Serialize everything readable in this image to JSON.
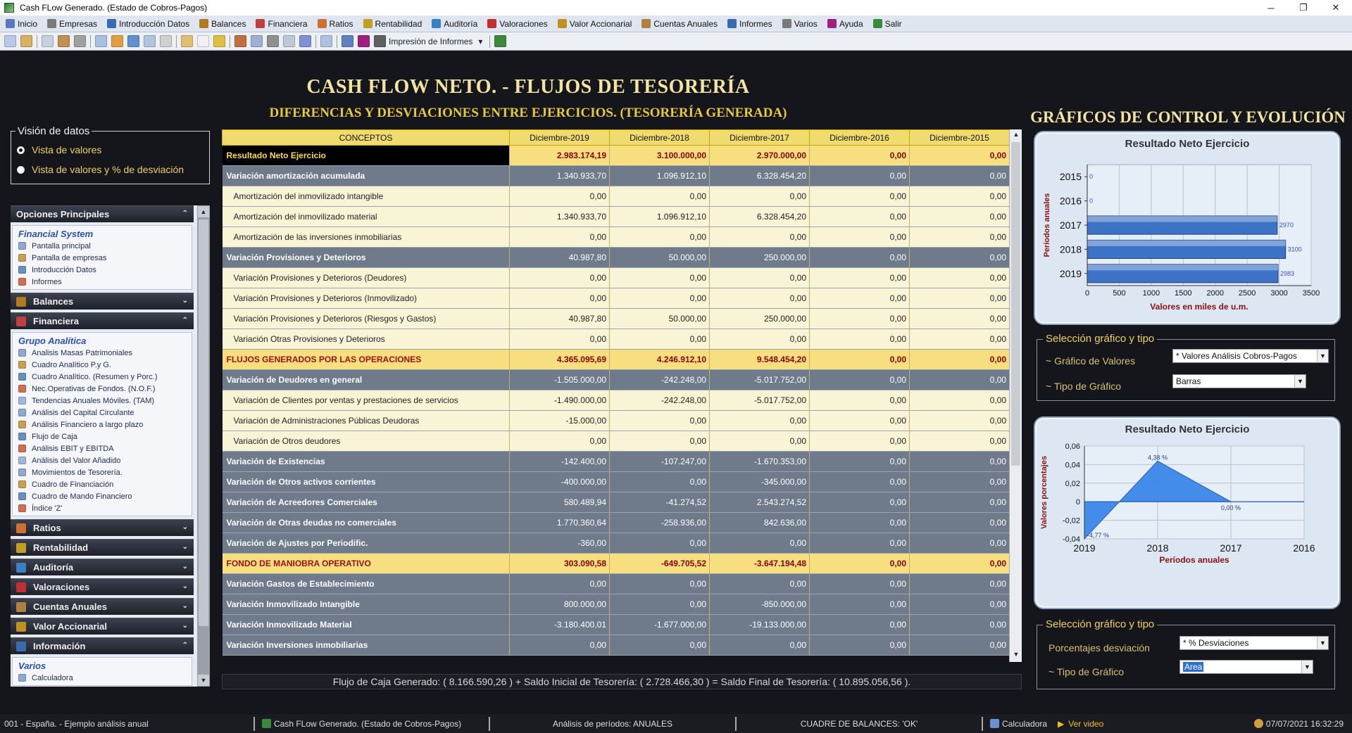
{
  "window": {
    "title": "Cash FLow Generado. (Estado de Cobros-Pagos)",
    "minimize": "─",
    "maximize": "❐",
    "close": "✕"
  },
  "menu": [
    {
      "label": "Inicio",
      "icon": "home-icon",
      "color": "#5a78c0"
    },
    {
      "label": "Empresas",
      "icon": "companies-icon",
      "color": "#7a7a7a"
    },
    {
      "label": "Introducción Datos",
      "icon": "data-entry-icon",
      "color": "#3a6ab0"
    },
    {
      "label": "Balances",
      "icon": "balance-icon",
      "color": "#b07a20"
    },
    {
      "label": "Financiera",
      "icon": "financial-icon",
      "color": "#c04040"
    },
    {
      "label": "Ratios",
      "icon": "ratios-icon",
      "color": "#d07030"
    },
    {
      "label": "Rentabilidad",
      "icon": "profitability-icon",
      "color": "#c0a020"
    },
    {
      "label": "Auditoría",
      "icon": "audit-icon",
      "color": "#3a80c0"
    },
    {
      "label": "Valoraciones",
      "icon": "valuation-icon",
      "color": "#c03030"
    },
    {
      "label": "Valor Accionarial",
      "icon": "shareholder-icon",
      "color": "#c09020"
    },
    {
      "label": "Cuentas Anuales",
      "icon": "annual-accounts-icon",
      "color": "#b08040"
    },
    {
      "label": "Informes",
      "icon": "reports-icon",
      "color": "#3a6ab0"
    },
    {
      "label": "Varios",
      "icon": "misc-icon",
      "color": "#7a7a7a"
    },
    {
      "label": "Ayuda",
      "icon": "help-icon",
      "color": "#a02080"
    },
    {
      "label": "Salir",
      "icon": "exit-icon",
      "color": "#3a8a3a"
    }
  ],
  "toolbar": {
    "print_label": "Impresión de Informes",
    "print_arrow": "▾"
  },
  "heading": {
    "title": "CASH FLOW NETO. - FLUJOS DE TESORERÍA",
    "subtitle": "DIFERENCIAS Y DESVIACIONES ENTRE EJERCICIOS. (TESORERÍA GENERADA)",
    "charts_title": "GRÁFICOS DE CONTROL Y EVOLUCIÓN"
  },
  "vision": {
    "legend": "Visión de datos",
    "options": [
      "Vista de valores",
      "Vista de valores y % de desviación"
    ],
    "selected": 0
  },
  "sidebar": {
    "sections": [
      {
        "label": "Opciones Principales",
        "icon": "main-options-icon",
        "color": "#3a6ab0",
        "expanded": true,
        "chev": "⌃",
        "group": "Financial System",
        "items": [
          "Pantalla principal",
          "Pantalla de empresas",
          "Introducción Datos",
          "Informes"
        ]
      },
      {
        "label": "Balances",
        "icon": "balance-icon",
        "color": "#b07a20",
        "expanded": false,
        "chev": "⌄"
      },
      {
        "label": "Financiera",
        "icon": "financial-icon",
        "color": "#c04040",
        "expanded": true,
        "chev": "⌃",
        "group": "Grupo Analítica",
        "items": [
          "Analisis Masas Patrimoniales",
          "Cuadro Analítico P.y G.",
          "Cuadro Analítico. (Resumen y Porc.)",
          "Nec.Operativas de Fondos. (N.O.F.)",
          "Tendencias Anuales Móviles. (TAM)",
          "Análisis del Capital Circulante",
          "Análisis Financiero a largo plazo",
          "Flujo de Caja",
          "Análisis EBIT y EBITDA",
          "Análisis del Valor Añadido",
          "Movimientos de Tesorería.",
          "Cuadro de Financiación",
          "Cuadro de Mando Financiero",
          "Índice 'Z'"
        ]
      },
      {
        "label": "Ratios",
        "icon": "ratios-icon",
        "color": "#d07030",
        "expanded": false,
        "chev": "⌄"
      },
      {
        "label": "Rentabilidad",
        "icon": "profitability-icon",
        "color": "#c0a020",
        "expanded": false,
        "chev": "⌄"
      },
      {
        "label": "Auditoría",
        "icon": "audit-icon",
        "color": "#3a80c0",
        "expanded": false,
        "chev": "⌄"
      },
      {
        "label": "Valoraciones",
        "icon": "valuation-icon",
        "color": "#c03030",
        "expanded": false,
        "chev": "⌄"
      },
      {
        "label": "Cuentas Anuales",
        "icon": "annual-accounts-icon",
        "color": "#b08040",
        "expanded": false,
        "chev": "⌄"
      },
      {
        "label": "Valor Accionarial",
        "icon": "shareholder-icon",
        "color": "#c09020",
        "expanded": false,
        "chev": "⌄"
      },
      {
        "label": "Información",
        "icon": "info-icon",
        "color": "#3a6ab0",
        "expanded": true,
        "chev": "⌃",
        "group": "Varios",
        "items": [
          "Calculadora"
        ]
      }
    ]
  },
  "table": {
    "headers": [
      "CONCEPTOS",
      "Diciembre-2019",
      "Diciembre-2018",
      "Diciembre-2017",
      "Diciembre-2016",
      "Diciembre-2015"
    ],
    "rows": [
      {
        "type": "first",
        "cells": [
          "Resultado Neto Ejercicio",
          "2.983.174,19",
          "3.100.000,00",
          "2.970.000,00",
          "0,00",
          "0,00"
        ]
      },
      {
        "type": "sub",
        "cells": [
          "Variación amortización acumulada",
          "1.340.933,70",
          "1.096.912,10",
          "6.328.454,20",
          "0,00",
          "0,00"
        ]
      },
      {
        "type": "det",
        "cells": [
          "Amortización del inmovilizado intangible",
          "0,00",
          "0,00",
          "0,00",
          "0,00",
          "0,00"
        ]
      },
      {
        "type": "det",
        "cells": [
          "Amortización del inmovilizado material",
          "1.340.933,70",
          "1.096.912,10",
          "6.328.454,20",
          "0,00",
          "0,00"
        ]
      },
      {
        "type": "det",
        "cells": [
          "Amortización de las inversiones inmobiliarias",
          "0,00",
          "0,00",
          "0,00",
          "0,00",
          "0,00"
        ]
      },
      {
        "type": "sub",
        "cells": [
          "Variación Provisiones y Deterioros",
          "40.987,80",
          "50.000,00",
          "250.000,00",
          "0,00",
          "0,00"
        ]
      },
      {
        "type": "det",
        "cells": [
          "Variación Provisiones y Deterioros (Deudores)",
          "0,00",
          "0,00",
          "0,00",
          "0,00",
          "0,00"
        ]
      },
      {
        "type": "det",
        "cells": [
          "Variación Provisiones y Deterioros (Inmovilizado)",
          "0,00",
          "0,00",
          "0,00",
          "0,00",
          "0,00"
        ]
      },
      {
        "type": "det",
        "cells": [
          "Variación Provisiones y Deterioros (Riesgos y Gastos)",
          "40.987,80",
          "50.000,00",
          "250.000,00",
          "0,00",
          "0,00"
        ]
      },
      {
        "type": "det",
        "cells": [
          "Variación Otras Provisiones y Deterioros",
          "0,00",
          "0,00",
          "0,00",
          "0,00",
          "0,00"
        ]
      },
      {
        "type": "hl",
        "cells": [
          "FLUJOS GENERADOS POR LAS OPERACIONES",
          "4.365.095,69",
          "4.246.912,10",
          "9.548.454,20",
          "0,00",
          "0,00"
        ]
      },
      {
        "type": "sub",
        "cells": [
          "Variación de Deudores en general",
          "-1.505.000,00",
          "-242.248,00",
          "-5.017.752,00",
          "0,00",
          "0,00"
        ]
      },
      {
        "type": "det",
        "cells": [
          "Variación de Clientes por ventas y prestaciones de servicios",
          "-1.490.000,00",
          "-242.248,00",
          "-5.017.752,00",
          "0,00",
          "0,00"
        ]
      },
      {
        "type": "det",
        "cells": [
          "Variación de Administraciones Públicas Deudoras",
          "-15.000,00",
          "0,00",
          "0,00",
          "0,00",
          "0,00"
        ]
      },
      {
        "type": "det",
        "cells": [
          "Variación de Otros deudores",
          "0,00",
          "0,00",
          "0,00",
          "0,00",
          "0,00"
        ]
      },
      {
        "type": "sub",
        "cells": [
          "Variación de Existencias",
          "-142.400,00",
          "-107.247,00",
          "-1.670.353,00",
          "0,00",
          "0,00"
        ]
      },
      {
        "type": "sub",
        "cells": [
          "Variación de Otros activos corrientes",
          "-400.000,00",
          "0,00",
          "-345.000,00",
          "0,00",
          "0,00"
        ]
      },
      {
        "type": "sub",
        "cells": [
          "Variación de Acreedores Comerciales",
          "580.489,94",
          "-41.274,52",
          "2.543.274,52",
          "0,00",
          "0,00"
        ]
      },
      {
        "type": "sub",
        "cells": [
          "Variación de Otras deudas no comerciales",
          "1.770.360,64",
          "-258.936,00",
          "842.636,00",
          "0,00",
          "0,00"
        ]
      },
      {
        "type": "sub",
        "cells": [
          "Variación de Ajustes por Periodific.",
          "-360,00",
          "0,00",
          "0,00",
          "0,00",
          "0,00"
        ]
      },
      {
        "type": "hl",
        "cells": [
          "FONDO DE MANIOBRA OPERATIVO",
          "303.090,58",
          "-649.705,52",
          "-3.647.194,48",
          "0,00",
          "0,00"
        ]
      },
      {
        "type": "sub",
        "cells": [
          "Variación Gastos de Establecimiento",
          "0,00",
          "0,00",
          "0,00",
          "0,00",
          "0,00"
        ]
      },
      {
        "type": "sub",
        "cells": [
          "Variación Inmovilizado Intangible",
          "800.000,00",
          "0,00",
          "-850.000,00",
          "0,00",
          "0,00"
        ]
      },
      {
        "type": "sub",
        "cells": [
          "Variación Inmovilizado Material",
          "-3.180.400,01",
          "-1.677.000,00",
          "-19.133.000,00",
          "0,00",
          "0,00"
        ]
      },
      {
        "type": "sub",
        "cells": [
          "Variación Inversiones inmobiliarias",
          "0,00",
          "0,00",
          "0,00",
          "0,00",
          "0,00"
        ]
      }
    ]
  },
  "summary": "Flujo de Caja Generado: ( 8.166.590,26 ) + Saldo Inicial de Tesorería: ( 2.728.466,30 )  = Saldo Final de Tesorería: ( 10.895.056,56 ).",
  "chart_data": [
    {
      "type": "bar",
      "orientation": "horizontal",
      "title": "Resultado Neto Ejercicio",
      "xlabel": "Valores en miles de u.m.",
      "ylabel": "Períodos anuales",
      "categories": [
        "2015",
        "2016",
        "2017",
        "2018",
        "2019"
      ],
      "values": [
        0,
        0,
        2970,
        3100,
        2983
      ],
      "data_labels": [
        "0",
        "0",
        "2970",
        "3100",
        "2983"
      ],
      "xlim": [
        0,
        3500
      ],
      "xticks": [
        "0",
        "500",
        "1000",
        "1500",
        "2000",
        "2500",
        "3000",
        "3500"
      ],
      "grid": true,
      "bar_color": "#3d73c7"
    },
    {
      "type": "area",
      "title": "Resultado Neto Ejercicio",
      "xlabel": "Períodos anuales",
      "ylabel": "Valores porcentajes",
      "categories": [
        "2019",
        "2018",
        "2017",
        "2016"
      ],
      "values": [
        -0.04,
        0.0438,
        0,
        0
      ],
      "data_labels": [
        "-4,77 %",
        "4,38 %",
        "0,00 %",
        ""
      ],
      "ylim": [
        -0.04,
        0.06
      ],
      "yticks": [
        "-0,04",
        "-0,02",
        "0",
        "0,02",
        "0,04",
        "0,06"
      ],
      "grid": true,
      "fill_color": "#3a86e8"
    }
  ],
  "selection1": {
    "legend": "Selección gráfico y tipo",
    "row1_label": "~ Gráfico de Valores",
    "row1_value": "* Valores Análisis Cobros-Pagos",
    "row2_label": "~ Tipo de Gráfico",
    "row2_value": "Barras"
  },
  "selection2": {
    "legend": "Selección gráfico y tipo",
    "row1_label": "Porcentajes desviación",
    "row1_value": "* % Desviaciones",
    "row2_label": "~ Tipo de Gráfico",
    "row2_value": "Area"
  },
  "status": {
    "company": "001 - España. - Ejemplo análisis anual",
    "screen": "Cash FLow Generado. (Estado de Cobros-Pagos)",
    "periods": "Análisis de períodos: ANUALES",
    "balance_check": "CUADRE DE BALANCES:  'OK'",
    "calculator": "Calculadora",
    "video": "Ver video",
    "datetime": "07/07/2021 16:32:29"
  }
}
